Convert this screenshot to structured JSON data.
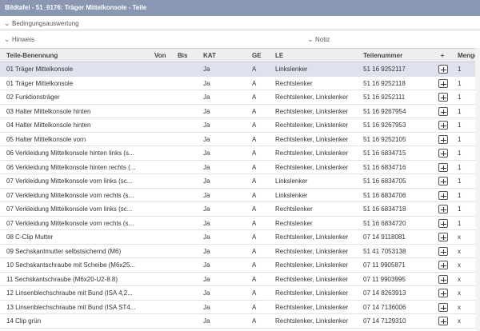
{
  "window": {
    "title": "Bildtafel - 51_9176: Träger Mittelkonsole - Teile"
  },
  "sections": {
    "bedingung": "Bedingungsauswertung",
    "hinweis": "Hinweis",
    "notiz": "Notiz",
    "chevron": "⌄"
  },
  "table": {
    "headers": {
      "name": "Teile-Benennung",
      "von": "Von",
      "bis": "Bis",
      "kat": "KAT",
      "ge": "GE",
      "le": "LE",
      "teil": "Teilenummer",
      "plus": "+",
      "menge": "Menge"
    },
    "rows": [
      {
        "name": "01 Träger Mittelkonsole",
        "von": "",
        "bis": "",
        "kat": "Ja",
        "ge": "A",
        "le": "Linkslenker",
        "teil": "51 16 9252117",
        "menge": "1",
        "selected": true
      },
      {
        "name": "01 Träger Mittelkonsole",
        "von": "",
        "bis": "",
        "kat": "Ja",
        "ge": "A",
        "le": "Rechtslenker",
        "teil": "51 16 9252118",
        "menge": "1"
      },
      {
        "name": "02 Funktionsträger",
        "von": "",
        "bis": "",
        "kat": "Ja",
        "ge": "A",
        "le": "Rechtslenker, Linkslenker",
        "teil": "51 16 9252111",
        "menge": "1"
      },
      {
        "name": "03 Halter Mittelkonsole hinten",
        "von": "",
        "bis": "",
        "kat": "Ja",
        "ge": "A",
        "le": "Rechtslenker, Linkslenker",
        "teil": "51 16 9267954",
        "menge": "1"
      },
      {
        "name": "04 Halter Mittelkonsole hinten",
        "von": "",
        "bis": "",
        "kat": "Ja",
        "ge": "A",
        "le": "Rechtslenker, Linkslenker",
        "teil": "51 16 9267953",
        "menge": "1"
      },
      {
        "name": "05 Halter Mittelkonsole vorn",
        "von": "",
        "bis": "",
        "kat": "Ja",
        "ge": "A",
        "le": "Rechtslenker, Linkslenker",
        "teil": "51 16 9252105",
        "menge": "1"
      },
      {
        "name": "06 Verkleidung Mittelkonsole hinten links (s...",
        "von": "",
        "bis": "",
        "kat": "Ja",
        "ge": "A",
        "le": "Rechtslenker, Linkslenker",
        "teil": "51 16 6834715",
        "menge": "1"
      },
      {
        "name": "06 Verkleidung Mittelkonsole hinten rechts (...",
        "von": "",
        "bis": "",
        "kat": "Ja",
        "ge": "A",
        "le": "Rechtslenker, Linkslenker",
        "teil": "51 16 6834716",
        "menge": "1"
      },
      {
        "name": "07 Verkleidung Mittelkonsole vorn links (sc...",
        "von": "",
        "bis": "",
        "kat": "Ja",
        "ge": "A",
        "le": "Linkslenker",
        "teil": "51 16 6834705",
        "menge": "1"
      },
      {
        "name": "07 Verkleidung Mittelkonsole vorn rechts (s...",
        "von": "",
        "bis": "",
        "kat": "Ja",
        "ge": "A",
        "le": "Linkslenker",
        "teil": "51 16 6834706",
        "menge": "1"
      },
      {
        "name": "07 Verkleidung Mittelkonsole vorn links (sc...",
        "von": "",
        "bis": "",
        "kat": "Ja",
        "ge": "A",
        "le": "Rechtslenker",
        "teil": "51 16 6834718",
        "menge": "1"
      },
      {
        "name": "07 Verkleidung Mittelkonsole vorn rechts (s...",
        "von": "",
        "bis": "",
        "kat": "Ja",
        "ge": "A",
        "le": "Rechtslenker",
        "teil": "51 16 6834720",
        "menge": "1"
      },
      {
        "name": "08 C-Clip Mutter",
        "von": "",
        "bis": "",
        "kat": "Ja",
        "ge": "A",
        "le": "Rechtslenker, Linkslenker",
        "teil": "07 14 9118081",
        "menge": "x"
      },
      {
        "name": "09 Sechskantmutter selbstsichernd (M6)",
        "von": "",
        "bis": "",
        "kat": "Ja",
        "ge": "A",
        "le": "Rechtslenker, Linkslenker",
        "teil": "51 41 7053138",
        "menge": "x"
      },
      {
        "name": "10 Sechskantschraube mit Scheibe (M6x25...",
        "von": "",
        "bis": "",
        "kat": "Ja",
        "ge": "A",
        "le": "Rechtslenker, Linkslenker",
        "teil": "07 11 9905871",
        "menge": "x"
      },
      {
        "name": "11 Sechskantschraube (M6x20-U2-8.8)",
        "von": "",
        "bis": "",
        "kat": "Ja",
        "ge": "A",
        "le": "Rechtslenker, Linkslenker",
        "teil": "07 11 9903995",
        "menge": "x"
      },
      {
        "name": "12 Linsenblechschraube mit Bund (ISA 4,2...",
        "von": "",
        "bis": "",
        "kat": "Ja",
        "ge": "A",
        "le": "Rechtslenker, Linkslenker",
        "teil": "07 14 8263913",
        "menge": "x"
      },
      {
        "name": "13 Linsenblechschraube mit Bund (ISA ST4...",
        "von": "",
        "bis": "",
        "kat": "Ja",
        "ge": "A",
        "le": "Rechtslenker, Linkslenker",
        "teil": "07 14 7136006",
        "menge": "x"
      },
      {
        "name": "14 Clip grün",
        "von": "",
        "bis": "",
        "kat": "Ja",
        "ge": "A",
        "le": "Rechtslenker, Linkslenker",
        "teil": "07 14 7129310",
        "menge": "x"
      }
    ]
  },
  "colors": {
    "titlebar": "#8a97b3",
    "selected_row": "#dde2ee",
    "header_bg": "#eeeeee"
  },
  "icons": {
    "add": "plus-square-icon",
    "expand": "chevron-down-icon"
  }
}
